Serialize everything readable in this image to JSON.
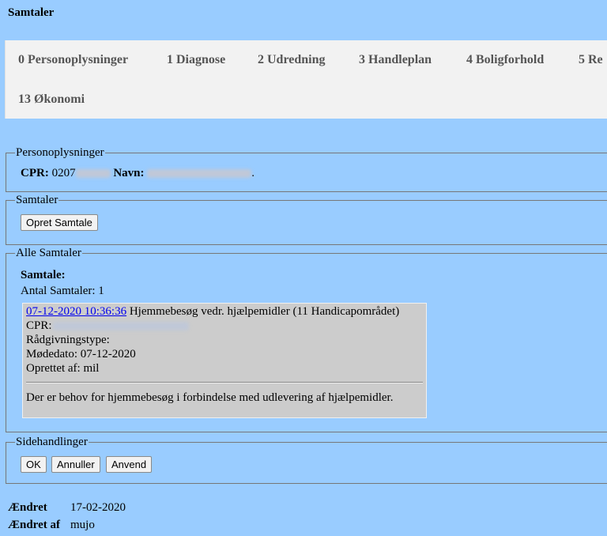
{
  "page": {
    "title": "Samtaler"
  },
  "tabs": [
    {
      "label": "0 Personoplysninger"
    },
    {
      "label": "1 Diagnose"
    },
    {
      "label": "2 Udredning"
    },
    {
      "label": "3 Handleplan"
    },
    {
      "label": "4 Boligforhold"
    },
    {
      "label": "5 Re"
    },
    {
      "label": "13 Økonomi"
    }
  ],
  "personoplysninger": {
    "legend": "Personoplysninger",
    "cpr_label": "CPR:",
    "cpr_value": "0207",
    "navn_label": "Navn:",
    "navn_suffix": "."
  },
  "samtaler": {
    "legend": "Samtaler",
    "create_button": "Opret Samtale"
  },
  "alle_samtaler": {
    "legend": "Alle Samtaler",
    "heading": "Samtale:",
    "count_text": "Antal Samtaler: 1",
    "entry": {
      "link": "07-12-2020 10:36:36",
      "title": " Hjemmebesøg vedr. hjælpemidler (11 Handicapområdet)",
      "cpr_label": "CPR:",
      "type_label": "Rådgivningstype:",
      "date_text": "Mødedato: 07-12-2020",
      "created_text": "Oprettet af: mil",
      "note": "Der er behov for hjemmebesøg i forbindelse med udlevering af hjælpemidler."
    }
  },
  "sidehandlinger": {
    "legend": "Sidehandlinger",
    "ok": "OK",
    "cancel": "Annuller",
    "apply": "Anvend"
  },
  "footer": {
    "changed_label": "Ændret",
    "changed_value": "17-02-2020",
    "changed_by_label": "Ændret af",
    "changed_by_value": "mujo"
  }
}
